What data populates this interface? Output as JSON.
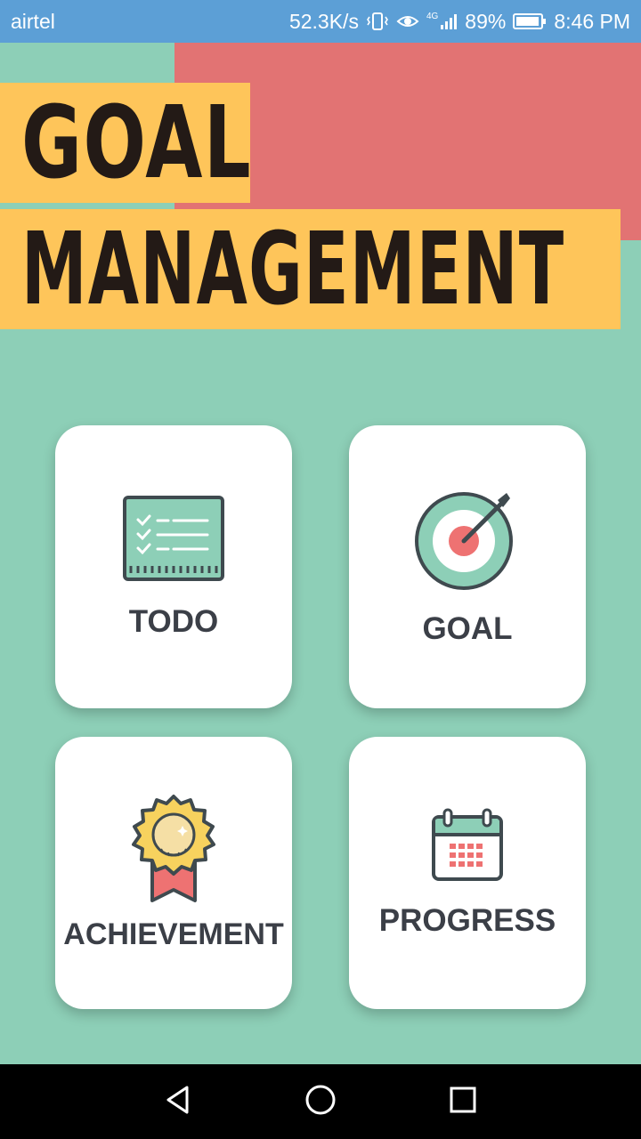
{
  "status_bar": {
    "carrier": "airtel",
    "speed": "52.3K/s",
    "network": "4G",
    "battery": "89%",
    "time": "8:46 PM"
  },
  "header": {
    "title_line1": "GOAL",
    "title_line2": "MANAGEMENT"
  },
  "menu": {
    "todo": {
      "label": "TODO",
      "icon": "checklist-icon"
    },
    "goal": {
      "label": "GOAL",
      "icon": "target-icon"
    },
    "achievement": {
      "label": "ACHIEVEMENT",
      "icon": "award-badge-icon"
    },
    "progress": {
      "label": "PROGRESS",
      "icon": "calendar-icon"
    }
  },
  "nav": {
    "back": "back-icon",
    "home": "home-icon",
    "recents": "recents-icon"
  },
  "colors": {
    "background": "#8dcfb7",
    "title_band": "#fec55a",
    "accent_red": "#e27373",
    "status_bar": "#5c9fd6",
    "card_text": "#3b3f47"
  }
}
